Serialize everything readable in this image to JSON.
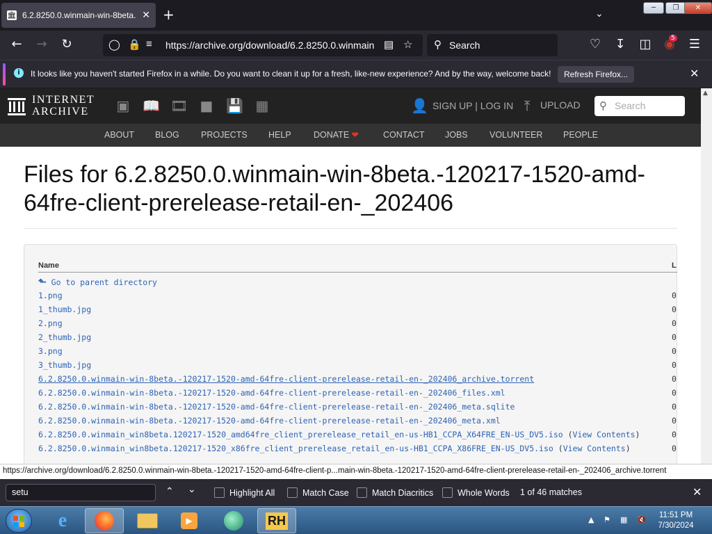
{
  "browser": {
    "tab_title": "6.2.8250.0.winmain-win-8beta.",
    "url": "https://archive.org/download/6.2.8250.0.winmain",
    "search_placeholder": "Search",
    "extension_badge": "5",
    "notification": {
      "message": "It looks like you haven't started Firefox in a while. Do you want to clean it up for a fresh, like-new experience? And by the way, welcome back!",
      "button": "Refresh Firefox..."
    },
    "status_url": "https://archive.org/download/6.2.8250.0.winmain-win-8beta.-120217-1520-amd-64fre-client-p...main-win-8beta.-120217-1520-amd-64fre-client-prerelease-retail-en-_202406_archive.torrent"
  },
  "ia_header": {
    "logo_line1": "INTERNET",
    "logo_line2": "ARCHIVE",
    "signup": "SIGN UP | LOG IN",
    "upload": "UPLOAD",
    "search_placeholder": "Search",
    "nav": [
      "ABOUT",
      "BLOG",
      "PROJECTS",
      "HELP",
      "DONATE",
      "CONTACT",
      "JOBS",
      "VOLUNTEER",
      "PEOPLE"
    ]
  },
  "main": {
    "title": "Files for 6.2.8250.0.winmain-win-8beta.-120217-1520-amd-64fre-client-prerelease-retail-en-_202406",
    "table": {
      "col_name": "Name",
      "col_last": "L",
      "parent_link": "Go to parent directory",
      "rows": [
        {
          "name": "1.png",
          "extra": "",
          "right": "0"
        },
        {
          "name": "1_thumb.jpg",
          "extra": "",
          "right": "0"
        },
        {
          "name": "2.png",
          "extra": "",
          "right": "0"
        },
        {
          "name": "2_thumb.jpg",
          "extra": "",
          "right": "0"
        },
        {
          "name": "3.png",
          "extra": "",
          "right": "0"
        },
        {
          "name": "3_thumb.jpg",
          "extra": "",
          "right": "0"
        },
        {
          "name": "6.2.8250.0.winmain-win-8beta.-120217-1520-amd-64fre-client-prerelease-retail-en-_202406_archive.torrent",
          "extra": "",
          "right": "0"
        },
        {
          "name": "6.2.8250.0.winmain-win-8beta.-120217-1520-amd-64fre-client-prerelease-retail-en-_202406_files.xml",
          "extra": "",
          "right": "0"
        },
        {
          "name": "6.2.8250.0.winmain-win-8beta.-120217-1520-amd-64fre-client-prerelease-retail-en-_202406_meta.sqlite",
          "extra": "",
          "right": "0"
        },
        {
          "name": "6.2.8250.0.winmain-win-8beta.-120217-1520-amd-64fre-client-prerelease-retail-en-_202406_meta.xml",
          "extra": "",
          "right": "0"
        },
        {
          "name": "6.2.8250.0.winmain_win8beta.120217-1520_amd64fre_client_prerelease_retail_en-us-HB1_CCPA_X64FRE_EN-US_DV5.iso",
          "extra": "View Contents",
          "right": "0"
        },
        {
          "name": "6.2.8250.0.winmain_win8beta.120217-1520_x86fre_client_prerelease_retail_en-us-HB1_CCPA_X86FRE_EN-US_DV5.iso",
          "extra": "View Contents",
          "right": "0"
        }
      ]
    }
  },
  "findbar": {
    "query": "setu",
    "options": [
      "Highlight All",
      "Match Case",
      "Match Diacritics",
      "Whole Words"
    ],
    "result": "1 of 46 matches"
  },
  "taskbar": {
    "time": "11:51 PM",
    "date": "7/30/2024"
  },
  "colors": {
    "link": "#2e63b5",
    "ia_dark": "#222222",
    "ff_chrome": "#2b2a33",
    "donate_heart": "#ee3322"
  }
}
